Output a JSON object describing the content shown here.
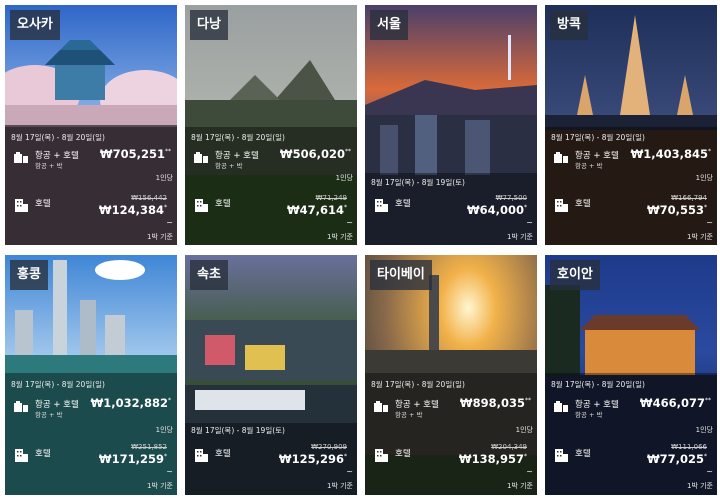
{
  "cards": [
    {
      "city": "오사카",
      "dates": "8월 17일(목) - 8월 20일(일)",
      "pkg_label": "항공 + 호텔",
      "pkg_sub": "항공 + 박",
      "pkg_price": "₩705,251",
      "pkg_sup": "**",
      "pkg_note": "1인당",
      "hotel_label": "호텔",
      "hotel_orig": "₩156,442",
      "hotel_price": "₩124,384",
      "hotel_sup": "*",
      "hotel_note": "1박 기준",
      "tilde": "~"
    },
    {
      "city": "다낭",
      "dates": "8월 17일(목) - 8월 20일(일)",
      "pkg_label": "항공 + 호텔",
      "pkg_sub": "항공 + 박",
      "pkg_price": "₩506,020",
      "pkg_sup": "**",
      "pkg_note": "1인당",
      "hotel_label": "호텔",
      "hotel_orig": "₩71,249",
      "hotel_price": "₩47,614",
      "hotel_sup": "*",
      "hotel_note": "1박 기준",
      "tilde": "~"
    },
    {
      "city": "서울",
      "dates": "8월 17일(목) - 8월 19일(토)",
      "pkg_label": "",
      "pkg_sub": "",
      "pkg_price": "",
      "pkg_sup": "",
      "pkg_note": "",
      "hotel_label": "호텔",
      "hotel_orig": "₩77,500",
      "hotel_price": "₩64,000",
      "hotel_sup": "*",
      "hotel_note": "1박 기준",
      "tilde": "~"
    },
    {
      "city": "방콕",
      "dates": "8월 17일(목) - 8월 20일(일)",
      "pkg_label": "항공 + 호텔",
      "pkg_sub": "항공 + 박",
      "pkg_price": "₩1,403,845",
      "pkg_sup": "*",
      "pkg_note": "1인당",
      "hotel_label": "호텔",
      "hotel_orig": "₩166,794",
      "hotel_price": "₩70,553",
      "hotel_sup": "*",
      "hotel_note": "1박 기준",
      "tilde": "~"
    },
    {
      "city": "홍콩",
      "dates": "8월 17일(목) - 8월 20일(일)",
      "pkg_label": "항공 + 호텔",
      "pkg_sub": "항공 + 박",
      "pkg_price": "₩1,032,882",
      "pkg_sup": "*",
      "pkg_note": "1인당",
      "hotel_label": "호텔",
      "hotel_orig": "₩251,852",
      "hotel_price": "₩171,259",
      "hotel_sup": "*",
      "hotel_note": "1박 기준",
      "tilde": "~"
    },
    {
      "city": "속초",
      "dates": "8월 17일(목) - 8월 19일(토)",
      "pkg_label": "",
      "pkg_sub": "",
      "pkg_price": "",
      "pkg_sup": "",
      "pkg_note": "",
      "hotel_label": "호텔",
      "hotel_orig": "₩270,909",
      "hotel_price": "₩125,296",
      "hotel_sup": "*",
      "hotel_note": "1박 기준",
      "tilde": "~"
    },
    {
      "city": "타이베이",
      "dates": "8월 17일(목) - 8월 20일(일)",
      "pkg_label": "항공 + 호텔",
      "pkg_sub": "항공 + 박",
      "pkg_price": "₩898,035",
      "pkg_sup": "**",
      "pkg_note": "1인당",
      "hotel_label": "호텔",
      "hotel_orig": "₩204,349",
      "hotel_price": "₩138,957",
      "hotel_sup": "*",
      "hotel_note": "1박 기준",
      "tilde": "~"
    },
    {
      "city": "호이안",
      "dates": "8월 17일(목) - 8월 20일(일)",
      "pkg_label": "항공 + 호텔",
      "pkg_sub": "항공 + 박",
      "pkg_price": "₩466,077",
      "pkg_sup": "**",
      "pkg_note": "1인당",
      "hotel_label": "호텔",
      "hotel_orig": "₩111,066",
      "hotel_price": "₩77,025",
      "hotel_sup": "*",
      "hotel_note": "1박 기준",
      "tilde": "~"
    }
  ],
  "icons": {
    "package": "suitcase-building-icon",
    "hotel": "hotel-building-icon"
  }
}
